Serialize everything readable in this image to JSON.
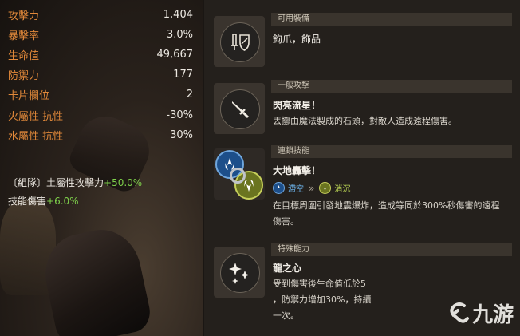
{
  "stats": [
    {
      "label": "攻擊力",
      "value": "1,404"
    },
    {
      "label": "暴擊率",
      "value": "3.0%"
    },
    {
      "label": "生命值",
      "value": "49,667"
    },
    {
      "label": "防禦力",
      "value": "177"
    },
    {
      "label": "卡片欄位",
      "value": "2"
    },
    {
      "label": "火屬性 抗性",
      "value": "-30%"
    },
    {
      "label": "水屬性 抗性",
      "value": "30%"
    }
  ],
  "bonuses": [
    {
      "text": "〔組隊〕土屬性攻擊力",
      "plus": "+50.0%"
    },
    {
      "text": "技能傷害",
      "plus": "+6.0%"
    }
  ],
  "equip": {
    "header": "可用裝備",
    "text": "鉤爪，飾品",
    "icon": "weapon-shield-icon"
  },
  "normal_attack": {
    "header": "一般攻擊",
    "title": "閃亮流星！",
    "desc": "丟擲由魔法製成的石頭，對敵人造成遠程傷害。",
    "icon": "sword-icon"
  },
  "chain_skill": {
    "header": "連鎖技能",
    "title": "大地轟擊！",
    "cond_from": "滯空",
    "arrows": "»",
    "cond_to": "消沉",
    "desc": "在目標周圍引發地震爆炸，造成等同於300%秒傷害的遠程傷害。",
    "colors": {
      "blue": "#2a6fb5",
      "olive": "#8e9a2a"
    }
  },
  "special": {
    "header": "特殊能力",
    "title": "龍之心",
    "desc_lines": [
      "受到傷害後生命值低於5",
      "，防禦力增加30%，持續",
      "一次。"
    ],
    "icon": "sparkle-icon"
  },
  "watermark": {
    "text": "九游"
  }
}
